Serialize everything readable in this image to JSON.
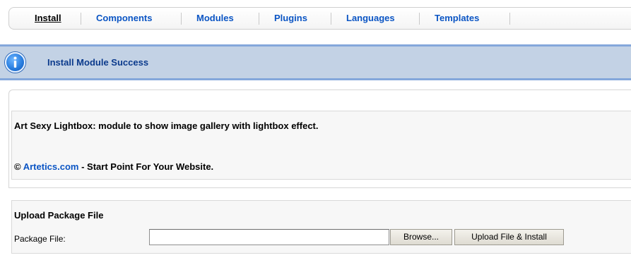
{
  "tabs": [
    {
      "label": "Install",
      "active": true
    },
    {
      "label": "Components"
    },
    {
      "label": "Modules"
    },
    {
      "label": "Plugins"
    },
    {
      "label": "Languages"
    },
    {
      "label": "Templates"
    }
  ],
  "message": {
    "icon": "info-icon",
    "text": "Install Module Success",
    "colors": {
      "background": "#c3d2e5",
      "border": "#84a7db",
      "text": "#0b3a8c"
    }
  },
  "description": {
    "line1": "Art Sexy Lightbox: module to show image gallery with lightbox effect.",
    "copyright_symbol": "©",
    "link_text": "Artetics.com",
    "line2_suffix": " - Start Point For Your Website."
  },
  "upload": {
    "title": "Upload Package File",
    "package_label": "Package File:",
    "file_value": "",
    "browse_label": "Browse...",
    "install_label": "Upload File & Install"
  },
  "colors": {
    "link": "#0b55c4"
  }
}
